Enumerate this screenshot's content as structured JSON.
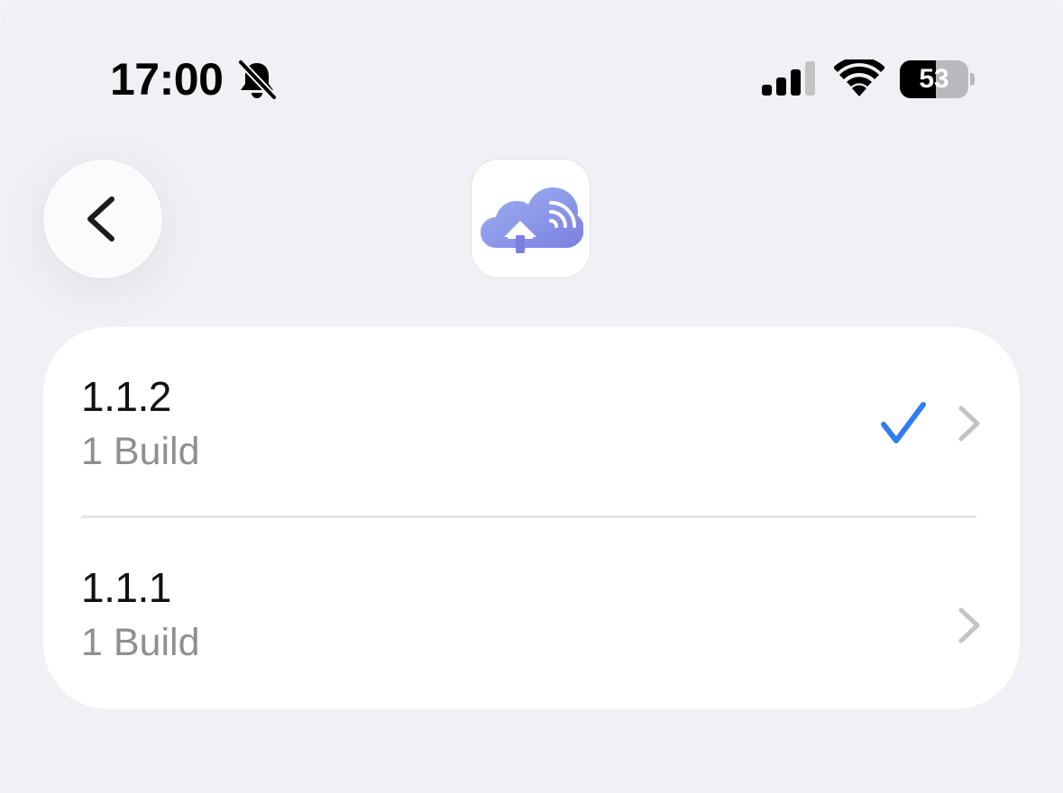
{
  "status_bar": {
    "time": "17:00",
    "battery_level": "53",
    "battery_fraction": 0.53,
    "icons": [
      "bell-slash-icon",
      "cellular-signal-icon",
      "wifi-icon",
      "battery-icon"
    ]
  },
  "nav": {
    "back_icon": "chevron-left-icon",
    "app_icon": "cloud-home-wifi-icon"
  },
  "versions": [
    {
      "version": "1.1.2",
      "builds": "1 Build",
      "selected": true
    },
    {
      "version": "1.1.1",
      "builds": "1 Build",
      "selected": false
    }
  ],
  "colors": {
    "background": "#f0f0f5",
    "card": "#ffffff",
    "accent": "#2f7cf6",
    "secondary_text": "#8e8e93",
    "chevron": "#c4c4c7"
  }
}
